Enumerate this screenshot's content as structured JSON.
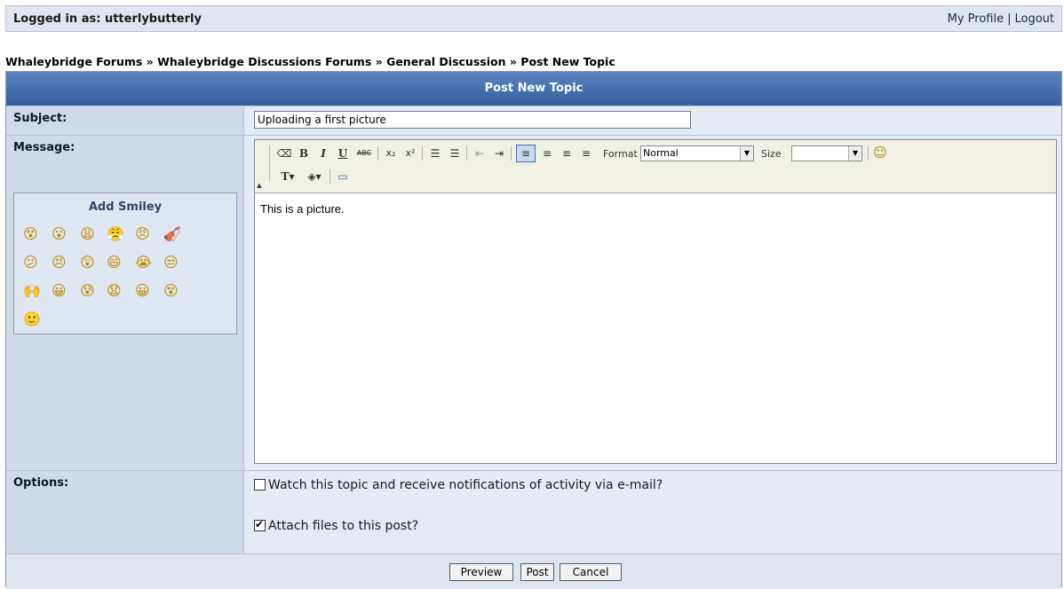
{
  "topbar": {
    "logged_in": "Logged in as: utterlybutterly",
    "profile": "My Profile",
    "logout": "Logout",
    "separator": "|"
  },
  "breadcrumb": {
    "items": [
      "Whaleybridge Forums",
      "Whaleybridge Discussions Forums",
      "General Discussion",
      "Post New Topic"
    ],
    "separator": "»"
  },
  "form": {
    "title": "Post New Topic",
    "subject_label": "Subject:",
    "subject_value": "Uploading a first picture",
    "message_label": "Message:",
    "smiley_title": "Add Smiley",
    "smileys": [
      "😵",
      "😮",
      "😩",
      "😤",
      "😠",
      "🎻",
      "😕",
      "😣",
      "😲",
      "😄",
      "😭",
      "😒",
      "🙌",
      "😀",
      "😰",
      "😧",
      "😀",
      "😵",
      "🙂"
    ],
    "toolbar": {
      "format_label": "Format",
      "format_value": "Normal",
      "size_label": "Size",
      "size_value": ""
    },
    "message_text": "This is a picture.",
    "options_label": "Options:",
    "option_watch": "Watch this topic and receive notifications of activity via e-mail?",
    "option_watch_checked": false,
    "option_attach": "Attach files to this post?",
    "option_attach_checked": true,
    "buttons": {
      "preview": "Preview",
      "post": "Post",
      "cancel": "Cancel"
    }
  },
  "colors": {
    "header": "#355f9f",
    "label_bg": "#cfdbea",
    "body_bg": "#e4ebf4"
  }
}
